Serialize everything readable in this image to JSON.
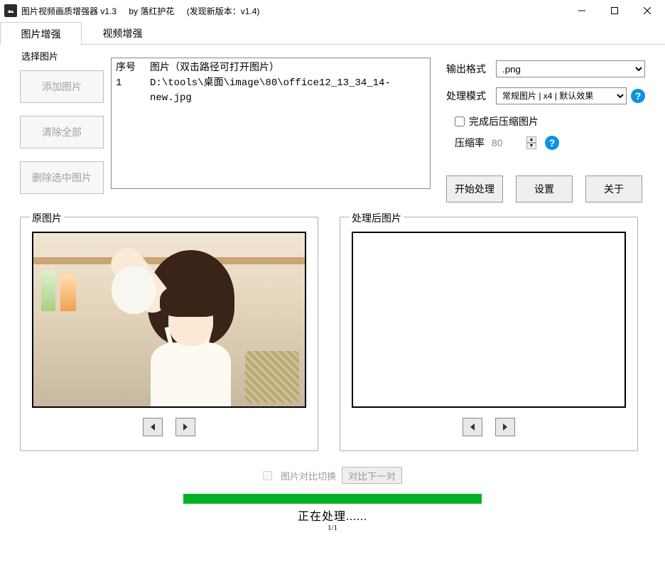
{
  "titlebar": {
    "app_name": "图片视频画质增强器 v1.3",
    "author": "by 落红护花",
    "new_version": "(发现新版本：v1.4)"
  },
  "tabs": {
    "image": "图片增强",
    "video": "视频增强"
  },
  "select_group": "选择图片",
  "buttons": {
    "add": "添加图片",
    "clear_all": "清除全部",
    "delete_selected": "删除选中图片"
  },
  "table": {
    "col_idx": "序号",
    "col_path": "图片（双击路径可打开图片）",
    "rows": [
      {
        "idx": "1",
        "path": "D:\\tools\\桌面\\image\\80\\office12_13_34_14-new.jpg"
      }
    ]
  },
  "right": {
    "output_format_label": "输出格式",
    "output_format_value": ".png",
    "process_mode_label": "处理模式",
    "process_mode_value": "常规图片 | x4 | 默认效果",
    "compress_after_label": "完成后压缩图片",
    "compress_rate_label": "压缩率",
    "compress_rate_value": "80"
  },
  "actions": {
    "start": "开始处理",
    "settings": "设置",
    "about": "关于"
  },
  "preview": {
    "original_label": "原图片",
    "processed_label": "处理后图片"
  },
  "lower": {
    "compare_toggle": "图片对比切换",
    "compare_next": "对比下一对"
  },
  "status": {
    "text": "正在处理......",
    "page": "1/1"
  },
  "progress_percent": 100
}
